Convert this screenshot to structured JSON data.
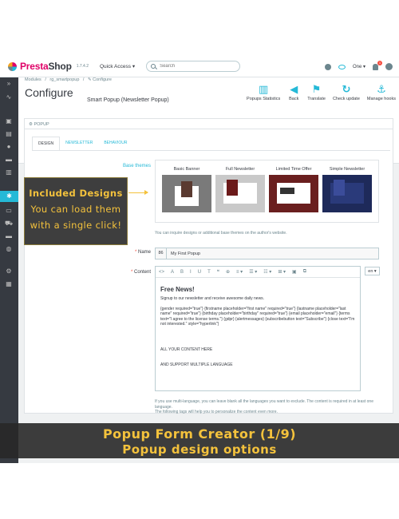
{
  "topbar": {
    "brand_presta": "Presta",
    "brand_shop": "Shop",
    "version": "1.7.4.2",
    "quick_access": "Quick Access ▾",
    "search_placeholder": "Search",
    "shop_selector": "One ▾",
    "notifications_count": "1"
  },
  "breadcrumb": [
    "Modules",
    "/",
    "rg_smartpopup",
    "/",
    "✎ Configure"
  ],
  "header": {
    "title": "Configure",
    "subtitle": "Smart Popup (Newsletter Popup)"
  },
  "toolbar": [
    {
      "label": "Popups Statistics",
      "icon": "chart-icon",
      "glyph": "▥"
    },
    {
      "label": "Back",
      "icon": "back-icon",
      "glyph": "◀"
    },
    {
      "label": "Translate",
      "icon": "flag-icon",
      "glyph": "⚑"
    },
    {
      "label": "Check update",
      "icon": "refresh-icon",
      "glyph": "↻"
    },
    {
      "label": "Manage hooks",
      "icon": "anchor-icon",
      "glyph": "⚓"
    }
  ],
  "panel": {
    "heading": "⚙ POPUP",
    "tabs": [
      "DESIGN",
      "NEWSLETTER",
      "BEHAVIOUR"
    ],
    "base_themes_label": "Base themes",
    "themes": [
      {
        "label": "Basic Banner",
        "bg": "#7a7a7a"
      },
      {
        "label": "Full Newsletter",
        "bg": "#c9c9c9"
      },
      {
        "label": "Limited Time Offer",
        "bg": "#6a1f1f"
      },
      {
        "label": "Simple Newsletter",
        "bg": "#1e2a5a"
      }
    ],
    "themes_help": "You can inquire designs or additional base themes on the author's website.",
    "name_label": "Name",
    "name_prefix": "86",
    "name_value": "My First Popup",
    "content_label": "Content",
    "lang": "en ▾",
    "editor_toolbar": [
      "<>",
      "A",
      "B",
      "I",
      "U",
      "T",
      "❝",
      "⊕",
      "≡ ▾",
      "☰ ▾",
      "☷ ▾",
      "⊞ ▾",
      "▣",
      "⧉"
    ],
    "editor": {
      "title": "Free News!",
      "intro": "Signup to our newsletter and receive awesome daily news.",
      "shortcode": "{gender required=\"true\"} {firstname placeholder=\"first name\" required=\"true\"} {lastname placeholder=\"last name\" required=\"true\"} {birthday placeholder=\"birthday\" required=\"true\"} {email placeholder=\"email\"} {terms text=\"I agree to the license terms.\"} {gdpr} {alertmessages} {subscribebutton text=\"Subscribe\"} {close text=\"I'm not interested.\" style=\"hyperlink\"}",
      "line1": "ALL YOUR CONTENT HERE",
      "line2": "AND SUPPORT MULTIPLE LANGUAGE"
    },
    "help_lines": [
      "If you use multi-language, you can leave blank all the languages you want to exclude. The content is required in at least one language.",
      "The following tags will help you to personalize the content even more."
    ]
  },
  "callout": {
    "line1": "Included Designs",
    "line2": "You can load them",
    "line3": "with a single click!"
  },
  "banner": {
    "line1": "Popup Form Creator (1/9)",
    "line2": "Popup design options"
  },
  "colors": {
    "accent": "#25b9d7",
    "brand": "#df0067",
    "sidebar": "#363a41",
    "callout_text": "#f4c23c"
  }
}
